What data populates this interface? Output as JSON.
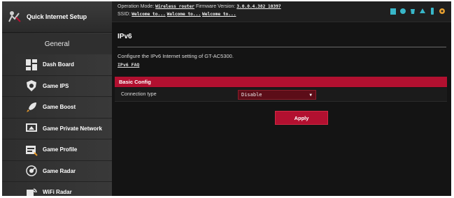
{
  "sidebar": {
    "qis_label": "Quick Internet Setup",
    "general_label": "General",
    "items": [
      {
        "label": "Dash Board",
        "icon": "dashboard-icon"
      },
      {
        "label": "Game IPS",
        "icon": "shield-icon"
      },
      {
        "label": "Game Boost",
        "icon": "rocket-icon"
      },
      {
        "label": "Game Private Network",
        "icon": "monitor-icon"
      },
      {
        "label": "Game Profile",
        "icon": "profile-icon"
      },
      {
        "label": "Game Radar",
        "icon": "radar-icon"
      },
      {
        "label": "WiFi Radar",
        "icon": "wifi-radar-icon"
      }
    ]
  },
  "banner": {
    "op_mode_label": "Operation Mode:",
    "op_mode_value": "Wireless router",
    "firmware_label": "Firmware Version:",
    "firmware_value": "3.0.0.4.382_10397",
    "ssid_label": "SSID:",
    "ssid_1": "Welcome to...",
    "ssid_2": "Welcome to...",
    "ssid_3": "Welcome to...",
    "status_icons": [
      "wifi-status-icon",
      "globe-icon",
      "usb-icon",
      "network-icon",
      "phone-icon",
      "gear-icon"
    ]
  },
  "main": {
    "title": "IPv6",
    "description": "Configure the IPv6 Internet setting of GT-AC5300.",
    "faq_link": "IPv6 FAQ",
    "section_title": "Basic Config",
    "connection_type_label": "Connection type",
    "connection_type_value": "Disable",
    "apply_label": "Apply"
  },
  "colors": {
    "accent": "#b21030",
    "background": "#141414",
    "sidebar": "#333333"
  }
}
